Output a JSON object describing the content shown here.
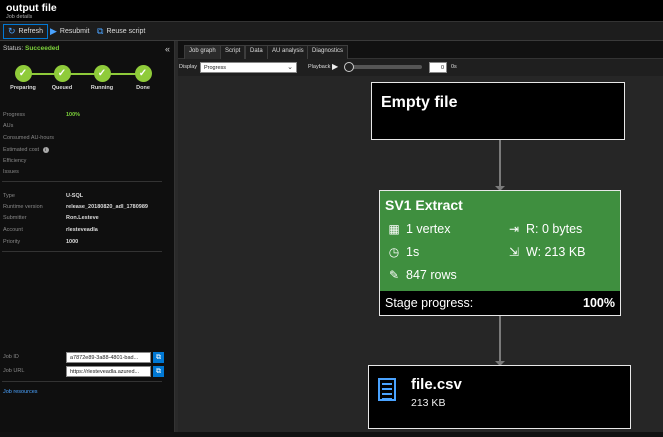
{
  "window": {
    "title": "output file",
    "subtitle": "Job details"
  },
  "toolbar": {
    "refresh": "Refresh",
    "resubmit": "Resubmit",
    "reuse": "Reuse script"
  },
  "status": {
    "label": "Status:",
    "value": "Succeeded"
  },
  "steps": [
    {
      "label": "Preparing"
    },
    {
      "label": "Queued"
    },
    {
      "label": "Running"
    },
    {
      "label": "Done"
    }
  ],
  "details": {
    "progress_label": "Progress",
    "progress_value": "100%",
    "aus_label": "AUs",
    "consumed_label": "Consumed AU-hours",
    "estcost_label": "Estimated cost",
    "efficiency_label": "Efficiency",
    "issues_label": "Issues"
  },
  "meta": [
    {
      "key": "Type",
      "value": "U-SQL"
    },
    {
      "key": "Runtime version",
      "value": "release_20180820_adl_1780989"
    },
    {
      "key": "Submitter",
      "value": "Ron.Lesteve"
    },
    {
      "key": "Account",
      "value": "rlesteveadla"
    },
    {
      "key": "Priority",
      "value": "1000"
    }
  ],
  "job": {
    "id_label": "Job ID",
    "id_value": "a7872e89-3a88-4801-bad...",
    "url_label": "Job URL",
    "url_value": "https://rlesteveadla.azured..."
  },
  "job_resources": "Job resources",
  "tabs": [
    "Job graph",
    "Script",
    "Data",
    "AU analysis",
    "Diagnostics"
  ],
  "controls": {
    "display_label": "Display",
    "display_value": "Progress",
    "playback_label": "Playback",
    "time_value": "0",
    "time_unit": "0s",
    "playback_position": 0
  },
  "graph": {
    "source": {
      "title": "Empty file"
    },
    "stage": {
      "title": "SV1 Extract",
      "vertex": "1 vertex",
      "time": "1s",
      "rows": "847 rows",
      "read": "R: 0 bytes",
      "write": "W: 213 KB",
      "progress_label": "Stage progress:",
      "progress_value": "100%",
      "color": "#3f8f3f"
    },
    "output": {
      "title": "file.csv",
      "size": "213 KB"
    }
  },
  "colors": {
    "accent": "#0078d4",
    "success": "#7cd13b",
    "stage_green": "#3f8f3f"
  }
}
